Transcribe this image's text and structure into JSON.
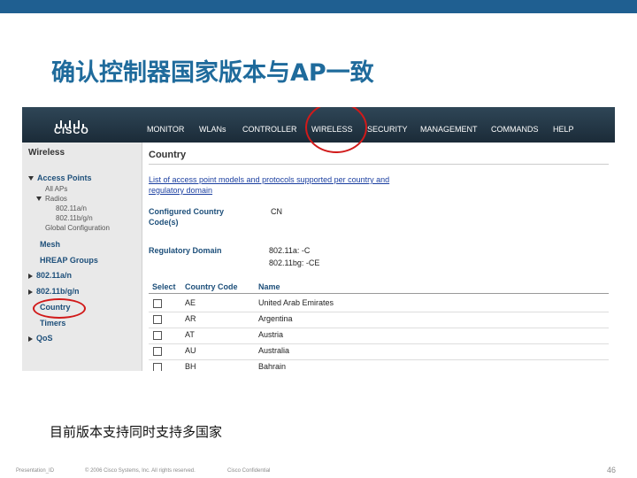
{
  "slide": {
    "title": "确认控制器国家版本与AP一致",
    "caption": "目前版本支持同时支持多国家",
    "footer": {
      "presentation": "Presentation_ID",
      "copyright": "© 2006 Cisco Systems, Inc. All rights reserved.",
      "confidential": "Cisco Confidential",
      "page": "46"
    }
  },
  "app": {
    "logo_text": "CISCO",
    "menu": [
      "MONITOR",
      "WLANs",
      "CONTROLLER",
      "WIRELESS",
      "SECURITY",
      "MANAGEMENT",
      "COMMANDS",
      "HELP"
    ],
    "highlight_color": "#d11a1a"
  },
  "sidebar": {
    "heading": "Wireless",
    "access_points": "Access Points",
    "all_aps": "All APs",
    "radios": "Radios",
    "radio_a": "802.11a/n",
    "radio_bg": "802.11b/g/n",
    "global_config": "Global Configuration",
    "mesh": "Mesh",
    "hreap": "HREAP Groups",
    "net_a": "802.11a/n",
    "net_bg": "802.11b/g/n",
    "country": "Country",
    "timers": "Timers",
    "qos": "QoS"
  },
  "main": {
    "title": "Country",
    "link_text": "List of access point models and protocols supported per country and regulatory domain",
    "configured_label": "Configured Country Code(s)",
    "configured_value": "CN",
    "regulatory_label": "Regulatory Domain",
    "regulatory_a": "802.11a: -C",
    "regulatory_bg": "802.11bg: -CE",
    "table": {
      "headers": [
        "Select",
        "Country Code",
        "Name"
      ],
      "rows": [
        {
          "code": "AE",
          "name": "United Arab Emirates"
        },
        {
          "code": "AR",
          "name": "Argentina"
        },
        {
          "code": "AT",
          "name": "Austria"
        },
        {
          "code": "AU",
          "name": "Australia"
        },
        {
          "code": "BH",
          "name": "Bahrain"
        }
      ]
    }
  }
}
